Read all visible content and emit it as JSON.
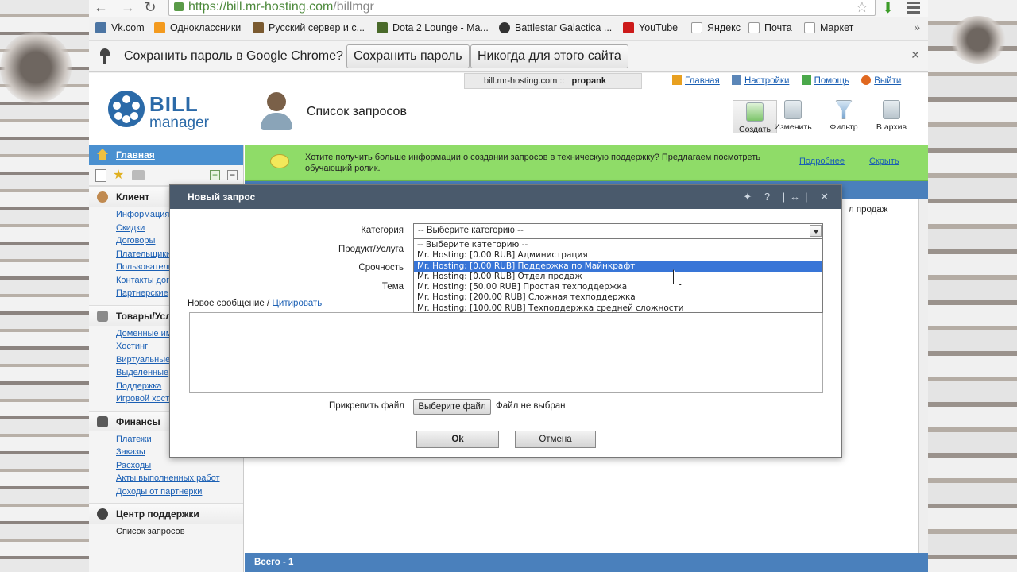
{
  "browser": {
    "url_prefix": "https://",
    "url_host": "bill.mr-hosting.com",
    "url_path": "/billmgr",
    "bookmarks": [
      "Vk.com",
      "Одноклассники",
      "Русский сервер и с...",
      "Dota 2 Lounge - Ma...",
      "Battlestar Galactica ...",
      "YouTube",
      "Яндекс",
      "Почта",
      "Маркет"
    ],
    "bookmarks_more": "»",
    "password_prompt": "Сохранить пароль в Google Chrome?",
    "save_password": "Сохранить пароль",
    "never_save": "Никогда для этого сайта"
  },
  "header": {
    "server": "bill.mr-hosting.com ::",
    "user": "propank",
    "links": [
      "Главная",
      "Настройки",
      "Помощь",
      "Выйти"
    ],
    "logo_top": "BILL",
    "logo_bottom": "manager",
    "page_title": "Список запросов",
    "toolbar": [
      "Создать",
      "Изменить",
      "Фильтр",
      "В архив"
    ]
  },
  "sidebar": {
    "main": "Главная",
    "sections": [
      {
        "title": "Клиент",
        "items": [
          "Информация",
          "Скидки",
          "Договоры",
          "Плательщики",
          "Пользователи",
          "Контакты договора",
          "Партнерские"
        ]
      },
      {
        "title": "Товары/Услуги",
        "items": [
          "Доменные имена",
          "Хостинг",
          "Виртуальные",
          "Выделенные",
          "Поддержка",
          "Игровой хостинг"
        ]
      },
      {
        "title": "Финансы",
        "items": [
          "Платежи",
          "Заказы",
          "Расходы",
          "Акты выполненных работ",
          "Доходы от партнерки"
        ]
      },
      {
        "title": "Центр поддержки",
        "items": [
          "Список запросов"
        ]
      }
    ]
  },
  "banner": {
    "text": "Хотите получить больше информации о создании запросов в техническую поддержку? Предлагаем посмотреть обучающий ролик.",
    "more": "Подробнее",
    "hide": "Скрыть"
  },
  "grid": {
    "cell": "л продаж",
    "footer": "Всего - 1"
  },
  "dialog": {
    "title": "Новый запрос",
    "icons": "✦ ? |↔| ✕",
    "category_label": "Категория",
    "product_label": "Продукт/Услуга",
    "urgency_label": "Срочность",
    "topic_label": "Тема",
    "category_value": "-- Выберите категорию --",
    "options": [
      "-- Выберите категорию --",
      "Mr. Hosting: [0.00 RUB] Администрация",
      "Mr. Hosting: [0.00 RUB] Поддержка по Майнкрафт",
      "Mr. Hosting: [0.00 RUB] Отдел продаж",
      "Mr. Hosting: [50.00 RUB] Простая техподдержка",
      "Mr. Hosting: [200.00 RUB] Сложная техподдержка",
      "Mr. Hosting: [100.00 RUB] Техподдержка средней сложности"
    ],
    "selected_option_index": 2,
    "new_message": "Новое сообщение",
    "separator": " / ",
    "quote": "Цитировать",
    "attach_label": "Прикрепить файл",
    "choose_file": "Выберите файл",
    "no_file": "Файл не выбран",
    "ok": "Ok",
    "cancel": "Отмена"
  }
}
